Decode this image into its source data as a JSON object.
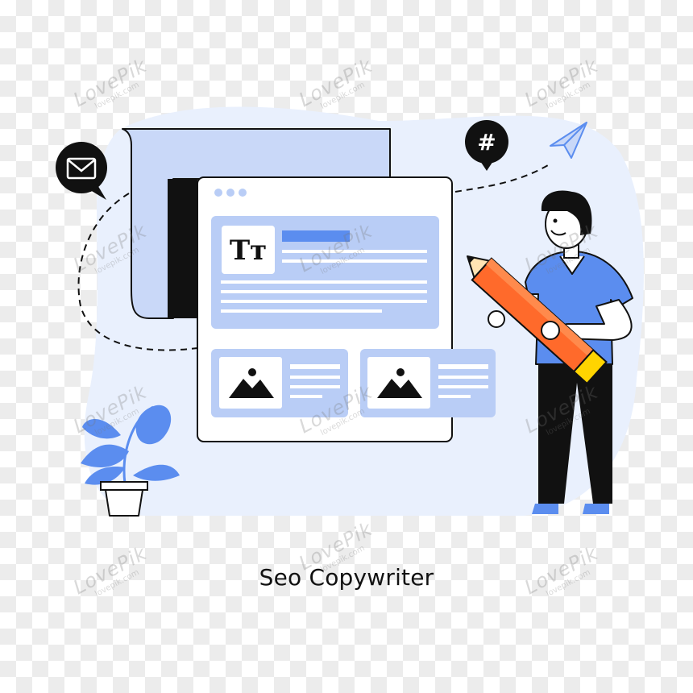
{
  "illustration": {
    "caption": "Seo Copywriter",
    "text_format_glyph": "Tт",
    "hashtag_glyph": "#",
    "icons": [
      "mail-icon",
      "hashtag-icon",
      "paper-plane-icon",
      "text-format-icon",
      "image-icon",
      "pencil-icon",
      "plant-icon",
      "person-figure"
    ],
    "colors": {
      "accent_blue": "#5b8def",
      "light_blue": "#c9d8f8",
      "pale_blue": "#e9f0fd",
      "pencil_orange": "#ff6a2b",
      "pencil_yellow": "#ffd400",
      "outline": "#111111"
    }
  },
  "watermark": {
    "brand": "LovePik",
    "site": "lovepik.com"
  }
}
